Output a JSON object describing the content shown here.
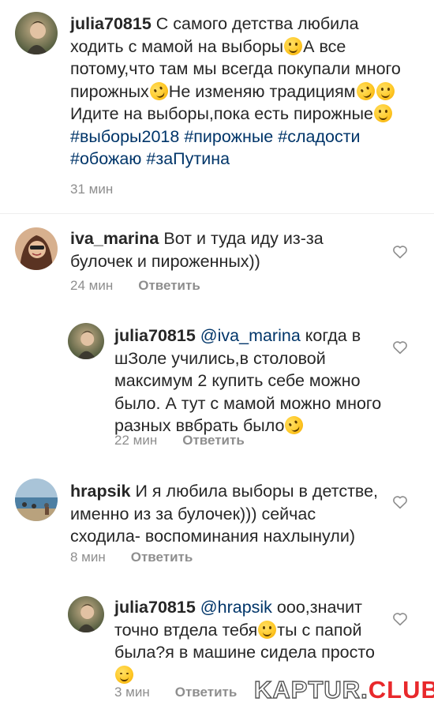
{
  "comments": [
    {
      "user": "julia70815",
      "parts": [
        {
          "t": "С самого детства любила ходить с мамой на выборы"
        },
        {
          "e": "smile"
        },
        {
          "t": "А все потому,что там мы всегда покупали много пирожных"
        },
        {
          "e": "laugh"
        },
        {
          "t": "Не изменяю традициям"
        },
        {
          "e": "laugh"
        },
        {
          "e": "smile"
        },
        {
          "t": "Идите на выборы,пока есть пирожные"
        },
        {
          "e": "smile"
        },
        {
          "t": " #выборы2018 #пирожные #сладости #обожаю #заПутина",
          "c": "tag"
        }
      ],
      "time": "31 мин",
      "reply": ""
    },
    {
      "user": "iva_marina",
      "parts": [
        {
          "t": "Вот и туда иду из-за булочек и пироженных))"
        }
      ],
      "time": "24 мин",
      "reply": "Ответить"
    },
    {
      "user": "julia70815",
      "parts": [
        {
          "t": "@iva_marina",
          "c": "mention"
        },
        {
          "t": " когда в шЗоле учились,в столовой максимум 2 купить себе можно было. А тут с мамой можно много разных ввбрать было"
        },
        {
          "e": "laugh"
        }
      ],
      "time": "22 мин",
      "reply": "Ответить"
    },
    {
      "user": "hrapsik",
      "parts": [
        {
          "t": "И я любила выборы в детстве, именно из за булочек))) сейчас сходила- воспоминания нахлынули)"
        }
      ],
      "time": "8 мин",
      "reply": "Ответить"
    },
    {
      "user": "julia70815",
      "parts": [
        {
          "t": "@hrapsik",
          "c": "mention"
        },
        {
          "t": " ооо,значит точно втдела тебя"
        },
        {
          "e": "smile"
        },
        {
          "t": "ты с папой была?я в машине сидела просто "
        },
        {
          "e": "wink"
        }
      ],
      "time": "3 мин",
      "reply": "Ответить"
    }
  ],
  "icons": {
    "like": "heart-outline-icon",
    "emoji_smile": "smiling-face-emoji",
    "emoji_laugh": "rolling-laughing-emoji",
    "emoji_wink": "winking-face-emoji"
  },
  "watermark": {
    "prefix": "KAPTUR.",
    "suffix": "CLUB"
  },
  "colors": {
    "text": "#262626",
    "meta": "#8e8e8e",
    "link": "#003569",
    "watermark_red": "#e8282b"
  }
}
